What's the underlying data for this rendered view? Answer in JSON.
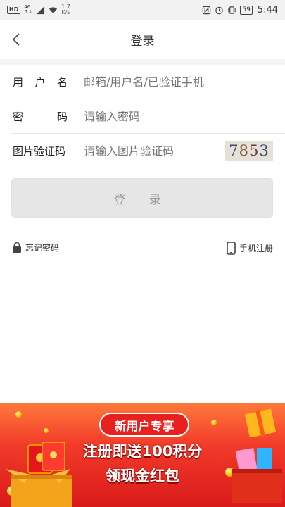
{
  "status_bar": {
    "hd": "HD",
    "net_top": "46",
    "net_bottom": "↑↓",
    "speed_value": "1.7",
    "speed_unit": "K/s",
    "battery": "59",
    "time": "5:44"
  },
  "header": {
    "title": "登录"
  },
  "form": {
    "username_label": "用 户 名",
    "username_placeholder": "邮箱/用户名/已验证手机",
    "password_label": "密 码",
    "password_placeholder": "请输入密码",
    "captcha_label": "图片验证码",
    "captcha_placeholder": "请输入图片验证码",
    "captcha_digits": [
      "7",
      "8",
      "5",
      "3"
    ]
  },
  "login_button": "登 录",
  "links": {
    "forgot": "忘记密码",
    "register": "手机注册"
  },
  "banner": {
    "pill": "新用户专享",
    "line1": "注册即送100积分",
    "line2": "领现金红包"
  },
  "colors": {
    "banner_red": "#d91a1a",
    "button_bg": "#e6e6e6",
    "placeholder": "#999999"
  }
}
